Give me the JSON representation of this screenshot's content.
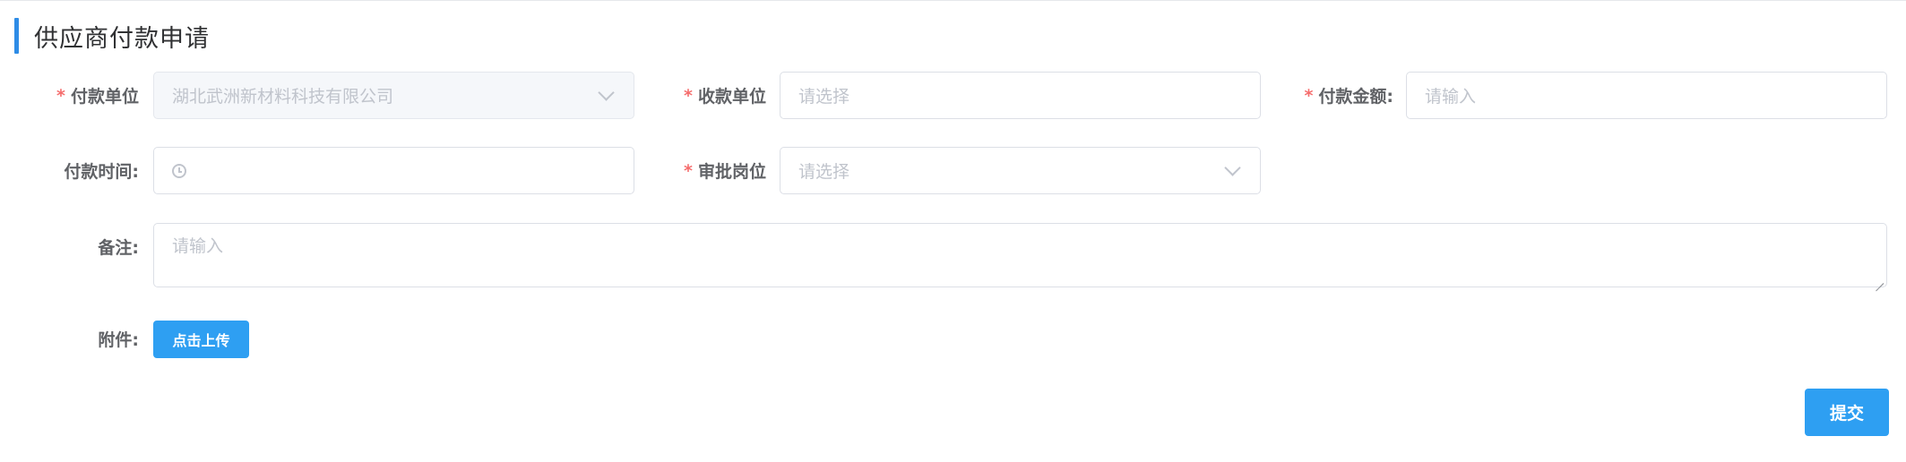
{
  "page": {
    "title": "供应商付款申请"
  },
  "form": {
    "payer": {
      "label": "付款单位",
      "value": "湖北武洲新材料科技有限公司"
    },
    "payee": {
      "label": "收款单位",
      "placeholder": "请选择"
    },
    "amount": {
      "label": "付款金额:",
      "placeholder": "请输入"
    },
    "pay_time": {
      "label": "付款时间:",
      "value": ""
    },
    "approval_post": {
      "label": "审批岗位",
      "placeholder": "请选择"
    },
    "remark": {
      "label": "备注:",
      "placeholder": "请输入"
    },
    "attachment": {
      "label": "附件:",
      "upload_button": "点击上传"
    }
  },
  "actions": {
    "submit_label": "提交"
  },
  "required_marker": "*",
  "colors": {
    "accent": "#2e8ce6",
    "required": "#f56c6c",
    "button": "#2e9ff2"
  }
}
